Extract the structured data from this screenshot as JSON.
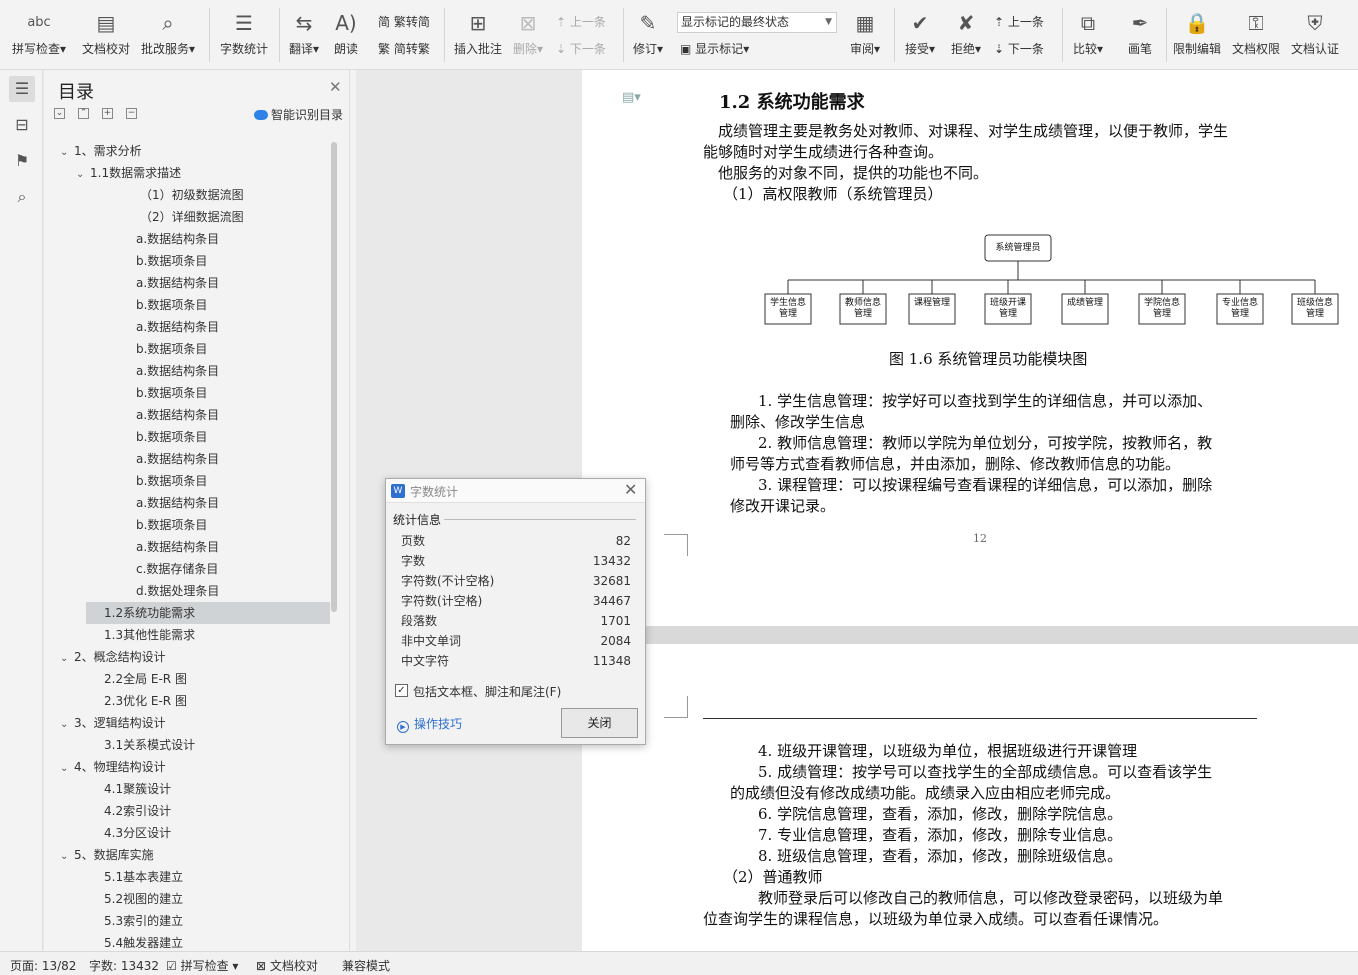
{
  "toolbar": {
    "spell": "拼写检查",
    "proof": "文档校对",
    "review_svc": "批改服务",
    "wordcount": "字数统计",
    "translate": "翻译",
    "read": "朗读",
    "trad": "繁转简",
    "simp": "简转繁",
    "insert_comment": "插入批注",
    "delete": "删除",
    "prev": "上一条",
    "next": "下一条",
    "revise": "修订",
    "markup_select": "显示标记的最终状态",
    "show_markup": "显示标记",
    "review": "审阅",
    "accept": "接受",
    "reject": "拒绝",
    "prev2": "上一条",
    "next2": "下一条",
    "compare": "比较",
    "pen": "画笔",
    "restrict": "限制编辑",
    "perm": "文档权限",
    "auth": "文档认证"
  },
  "toc": {
    "title": "目录",
    "smart": "智能识别目录",
    "items": [
      {
        "label": "1、需求分析",
        "toggle": "⌄"
      },
      {
        "label": "1.1数据需求描述",
        "toggle": "⌄"
      },
      {
        "label": "（1）初级数据流图"
      },
      {
        "label": "（2）详细数据流图"
      },
      {
        "label": "a.数据结构条目"
      },
      {
        "label": "b.数据项条目"
      },
      {
        "label": "a.数据结构条目"
      },
      {
        "label": "b.数据项条目"
      },
      {
        "label": "a.数据结构条目"
      },
      {
        "label": "b.数据项条目"
      },
      {
        "label": "a.数据结构条目"
      },
      {
        "label": "b.数据项条目"
      },
      {
        "label": "a.数据结构条目"
      },
      {
        "label": "b.数据项条目"
      },
      {
        "label": "a.数据结构条目"
      },
      {
        "label": "b.数据项条目"
      },
      {
        "label": "a.数据结构条目"
      },
      {
        "label": "b.数据项条目"
      },
      {
        "label": "a.数据结构条目"
      },
      {
        "label": "c.数据存储条目"
      },
      {
        "label": "d.数据处理条目"
      },
      {
        "label": "1.2系统功能需求"
      },
      {
        "label": "1.3其他性能需求"
      },
      {
        "label": "2、概念结构设计",
        "toggle": "⌄"
      },
      {
        "label": "2.2全局 E-R 图"
      },
      {
        "label": "2.3优化 E-R 图"
      },
      {
        "label": "3、逻辑结构设计",
        "toggle": "⌄"
      },
      {
        "label": "3.1关系模式设计"
      },
      {
        "label": "4、物理结构设计",
        "toggle": "⌄"
      },
      {
        "label": "4.1聚簇设计"
      },
      {
        "label": "4.2索引设计"
      },
      {
        "label": "4.3分区设计"
      },
      {
        "label": "5、数据库实施",
        "toggle": "⌄"
      },
      {
        "label": "5.1基本表建立"
      },
      {
        "label": "5.2视图的建立"
      },
      {
        "label": "5.3索引的建立"
      },
      {
        "label": "5.4触发器建立"
      }
    ]
  },
  "doc": {
    "heading": "1.2  系统功能需求",
    "p1a": "成绩管理主要是教务处对教师、对课程、对学生成绩管理，以便于教师，学生",
    "p1b": "能够随时对学生成绩进行各种查询。",
    "p2": "他服务的对象不同，提供的功能也不同。",
    "p3": "（1）高权限教师（系统管理员）",
    "chart_root": "系统管理员",
    "chart_nodes": [
      "学生信息管理",
      "教师信息管理",
      "课程管理",
      "班级开课管理",
      "成绩管理",
      "学院信息管理",
      "专业信息管理",
      "班级信息管理"
    ],
    "caption": "图  1.6 系统管理员功能模块图",
    "l1a": "1.   学生信息管理：按学好可以查找到学生的详细信息，并可以添加、",
    "l1b": "删除、修改学生信息",
    "l2a": "2.   教师信息管理：教师以学院为单位划分，可按学院，按教师名，教",
    "l2b": "师号等方式查看教师信息，并由添加，删除、修改教师信息的功能。",
    "l3a": "3.   课程管理：可以按课程编号查看课程的详细信息，可以添加，删除",
    "l3b": "修改开课记录。",
    "pageno": "12",
    "l4": "4.   班级开课管理，以班级为单位，根据班级进行开课管理",
    "l5a": "5.   成绩管理：按学号可以查找学生的全部成绩信息。可以查看该学生",
    "l5b": "的成绩但没有修改成绩功能。成绩录入应由相应老师完成。",
    "l6": "6.   学院信息管理，查看，添加，修改，删除学院信息。",
    "l7": "7.   专业信息管理，查看，添加，修改，删除专业信息。",
    "l8": "8.   班级信息管理，查看，添加，修改，删除班级信息。",
    "p4": "（2）普通教师",
    "p5a": "教师登录后可以修改自己的教师信息，可以修改登录密码，以班级为单",
    "p5b": "位查询学生的课程信息，以班级为单位录入成绩。可以查看任课情况。"
  },
  "dialog": {
    "title": "字数统计",
    "group": "统计信息",
    "rows": [
      {
        "k": "页数",
        "v": "82"
      },
      {
        "k": "字数",
        "v": "13432"
      },
      {
        "k": "字符数(不计空格)",
        "v": "32681"
      },
      {
        "k": "字符数(计空格)",
        "v": "34467"
      },
      {
        "k": "段落数",
        "v": "1701"
      },
      {
        "k": "非中文单词",
        "v": "2084"
      },
      {
        "k": "中文字符",
        "v": "11348"
      }
    ],
    "checkbox": "包括文本框、脚注和尾注(F)",
    "checked": true,
    "tips": "操作技巧",
    "close": "关闭"
  },
  "status": {
    "page": "页面: 13/82",
    "words": "字数: 13432",
    "spell": "拼写检查",
    "proof": "文档校对",
    "compat": "兼容模式"
  }
}
